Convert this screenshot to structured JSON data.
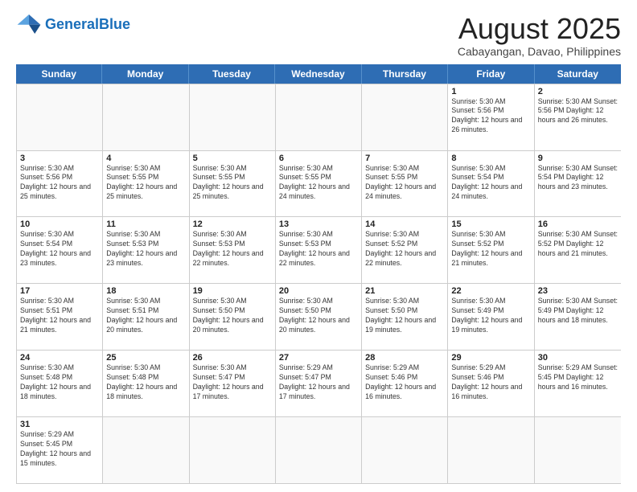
{
  "header": {
    "logo_general": "General",
    "logo_blue": "Blue",
    "title": "August 2025",
    "subtitle": "Cabayangan, Davao, Philippines"
  },
  "weekdays": [
    "Sunday",
    "Monday",
    "Tuesday",
    "Wednesday",
    "Thursday",
    "Friday",
    "Saturday"
  ],
  "rows": [
    [
      {
        "date": "",
        "info": ""
      },
      {
        "date": "",
        "info": ""
      },
      {
        "date": "",
        "info": ""
      },
      {
        "date": "",
        "info": ""
      },
      {
        "date": "",
        "info": ""
      },
      {
        "date": "1",
        "info": "Sunrise: 5:30 AM\nSunset: 5:56 PM\nDaylight: 12 hours and 26 minutes."
      },
      {
        "date": "2",
        "info": "Sunrise: 5:30 AM\nSunset: 5:56 PM\nDaylight: 12 hours and 26 minutes."
      }
    ],
    [
      {
        "date": "3",
        "info": "Sunrise: 5:30 AM\nSunset: 5:56 PM\nDaylight: 12 hours and 25 minutes."
      },
      {
        "date": "4",
        "info": "Sunrise: 5:30 AM\nSunset: 5:55 PM\nDaylight: 12 hours and 25 minutes."
      },
      {
        "date": "5",
        "info": "Sunrise: 5:30 AM\nSunset: 5:55 PM\nDaylight: 12 hours and 25 minutes."
      },
      {
        "date": "6",
        "info": "Sunrise: 5:30 AM\nSunset: 5:55 PM\nDaylight: 12 hours and 24 minutes."
      },
      {
        "date": "7",
        "info": "Sunrise: 5:30 AM\nSunset: 5:55 PM\nDaylight: 12 hours and 24 minutes."
      },
      {
        "date": "8",
        "info": "Sunrise: 5:30 AM\nSunset: 5:54 PM\nDaylight: 12 hours and 24 minutes."
      },
      {
        "date": "9",
        "info": "Sunrise: 5:30 AM\nSunset: 5:54 PM\nDaylight: 12 hours and 23 minutes."
      }
    ],
    [
      {
        "date": "10",
        "info": "Sunrise: 5:30 AM\nSunset: 5:54 PM\nDaylight: 12 hours and 23 minutes."
      },
      {
        "date": "11",
        "info": "Sunrise: 5:30 AM\nSunset: 5:53 PM\nDaylight: 12 hours and 23 minutes."
      },
      {
        "date": "12",
        "info": "Sunrise: 5:30 AM\nSunset: 5:53 PM\nDaylight: 12 hours and 22 minutes."
      },
      {
        "date": "13",
        "info": "Sunrise: 5:30 AM\nSunset: 5:53 PM\nDaylight: 12 hours and 22 minutes."
      },
      {
        "date": "14",
        "info": "Sunrise: 5:30 AM\nSunset: 5:52 PM\nDaylight: 12 hours and 22 minutes."
      },
      {
        "date": "15",
        "info": "Sunrise: 5:30 AM\nSunset: 5:52 PM\nDaylight: 12 hours and 21 minutes."
      },
      {
        "date": "16",
        "info": "Sunrise: 5:30 AM\nSunset: 5:52 PM\nDaylight: 12 hours and 21 minutes."
      }
    ],
    [
      {
        "date": "17",
        "info": "Sunrise: 5:30 AM\nSunset: 5:51 PM\nDaylight: 12 hours and 21 minutes."
      },
      {
        "date": "18",
        "info": "Sunrise: 5:30 AM\nSunset: 5:51 PM\nDaylight: 12 hours and 20 minutes."
      },
      {
        "date": "19",
        "info": "Sunrise: 5:30 AM\nSunset: 5:50 PM\nDaylight: 12 hours and 20 minutes."
      },
      {
        "date": "20",
        "info": "Sunrise: 5:30 AM\nSunset: 5:50 PM\nDaylight: 12 hours and 20 minutes."
      },
      {
        "date": "21",
        "info": "Sunrise: 5:30 AM\nSunset: 5:50 PM\nDaylight: 12 hours and 19 minutes."
      },
      {
        "date": "22",
        "info": "Sunrise: 5:30 AM\nSunset: 5:49 PM\nDaylight: 12 hours and 19 minutes."
      },
      {
        "date": "23",
        "info": "Sunrise: 5:30 AM\nSunset: 5:49 PM\nDaylight: 12 hours and 18 minutes."
      }
    ],
    [
      {
        "date": "24",
        "info": "Sunrise: 5:30 AM\nSunset: 5:48 PM\nDaylight: 12 hours and 18 minutes."
      },
      {
        "date": "25",
        "info": "Sunrise: 5:30 AM\nSunset: 5:48 PM\nDaylight: 12 hours and 18 minutes."
      },
      {
        "date": "26",
        "info": "Sunrise: 5:30 AM\nSunset: 5:47 PM\nDaylight: 12 hours and 17 minutes."
      },
      {
        "date": "27",
        "info": "Sunrise: 5:29 AM\nSunset: 5:47 PM\nDaylight: 12 hours and 17 minutes."
      },
      {
        "date": "28",
        "info": "Sunrise: 5:29 AM\nSunset: 5:46 PM\nDaylight: 12 hours and 16 minutes."
      },
      {
        "date": "29",
        "info": "Sunrise: 5:29 AM\nSunset: 5:46 PM\nDaylight: 12 hours and 16 minutes."
      },
      {
        "date": "30",
        "info": "Sunrise: 5:29 AM\nSunset: 5:45 PM\nDaylight: 12 hours and 16 minutes."
      }
    ],
    [
      {
        "date": "31",
        "info": "Sunrise: 5:29 AM\nSunset: 5:45 PM\nDaylight: 12 hours and 15 minutes."
      },
      {
        "date": "",
        "info": ""
      },
      {
        "date": "",
        "info": ""
      },
      {
        "date": "",
        "info": ""
      },
      {
        "date": "",
        "info": ""
      },
      {
        "date": "",
        "info": ""
      },
      {
        "date": "",
        "info": ""
      }
    ]
  ]
}
